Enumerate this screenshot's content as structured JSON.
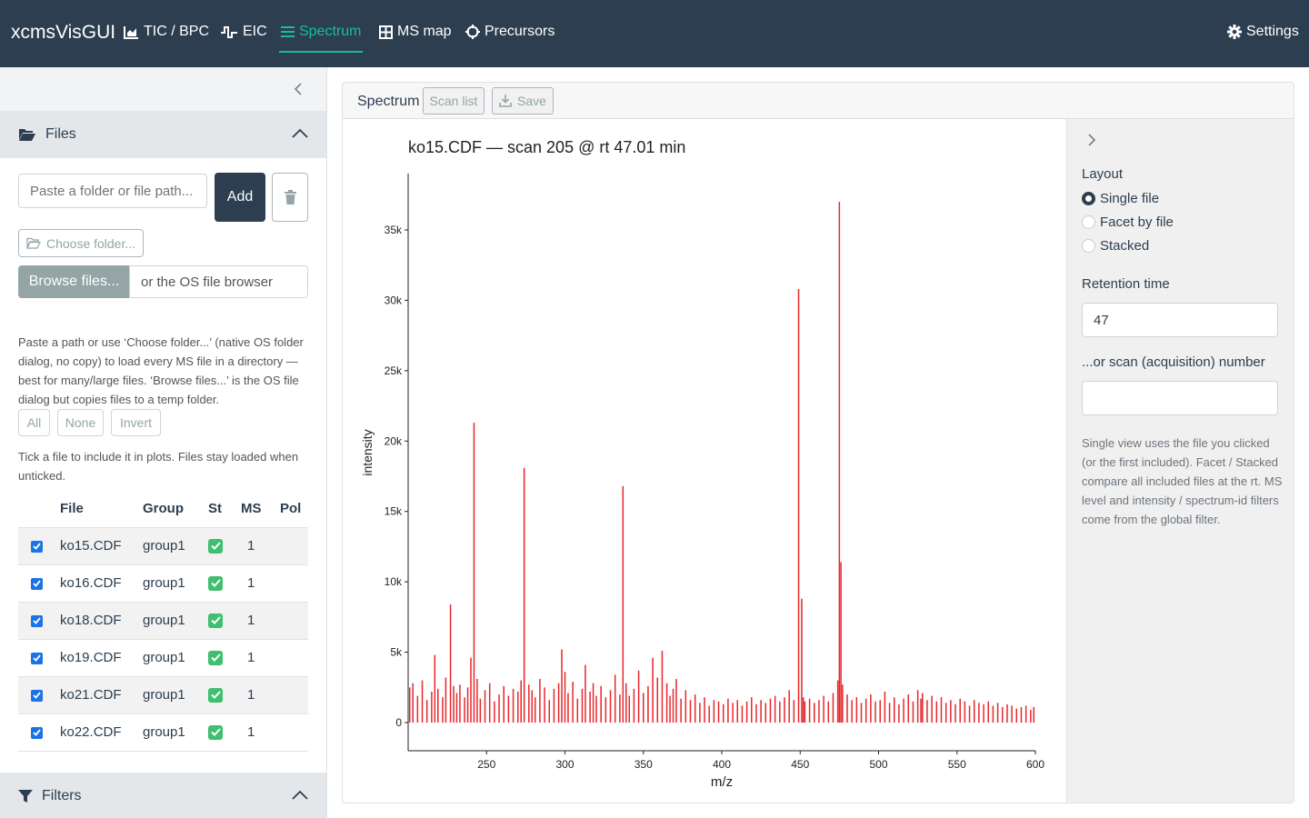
{
  "app": {
    "brand": "xcmsVisGUI"
  },
  "nav": {
    "tic": "TIC / BPC",
    "eic": "EIC",
    "spectrum": "Spectrum",
    "msmap": "MS map",
    "precursors": "Precursors",
    "settings": "Settings"
  },
  "sidebar": {
    "files_header": "Files",
    "path_placeholder": "Paste a folder or file path...",
    "add_label": "Add",
    "choose_folder_label": "Choose folder...",
    "browse_label": "Browse files...",
    "browse_hint": "or the OS file browser",
    "help_text": "Paste a path or use ‘Choose folder...’ (native OS folder dialog, no copy) to load every MS file in a directory — best for many/large files. ‘Browse files...’ is the OS file dialog but copies files to a temp folder.",
    "select_all": "All",
    "select_none": "None",
    "select_invert": "Invert",
    "tick_help": "Tick a file to include it in plots. Files stay loaded when unticked.",
    "table_headers": {
      "file": "File",
      "group": "Group",
      "st": "St",
      "ms": "MS",
      "pol": "Pol"
    },
    "files": [
      {
        "name": "ko15.CDF",
        "group": "group1",
        "ms": "1",
        "pol": ""
      },
      {
        "name": "ko16.CDF",
        "group": "group1",
        "ms": "1",
        "pol": ""
      },
      {
        "name": "ko18.CDF",
        "group": "group1",
        "ms": "1",
        "pol": ""
      },
      {
        "name": "ko19.CDF",
        "group": "group1",
        "ms": "1",
        "pol": ""
      },
      {
        "name": "ko21.CDF",
        "group": "group1",
        "ms": "1",
        "pol": ""
      },
      {
        "name": "ko22.CDF",
        "group": "group1",
        "ms": "1",
        "pol": ""
      }
    ],
    "filters_header": "Filters"
  },
  "main": {
    "card_title": "Spectrum",
    "scan_list_label": "Scan list",
    "save_label": "Save"
  },
  "options": {
    "layout_label": "Layout",
    "layout_single": "Single file",
    "layout_facet": "Facet by file",
    "layout_stacked": "Stacked",
    "rt_label": "Retention time",
    "rt_value": "47",
    "scan_label": "...or scan (acquisition) number",
    "scan_value": "",
    "help_text": "Single view uses the file you clicked (or the first included). Facet / Stacked compare all included files at the rt. MS level and intensity / spectrum-id filters come from the global filter."
  },
  "chart_data": {
    "type": "bar",
    "title": "ko15.CDF — scan 205 @ rt 47.01 min",
    "xlabel": "m/z",
    "ylabel": "intensity",
    "xlim": [
      200,
      600
    ],
    "ylim": [
      -2000,
      39000
    ],
    "x_ticks": [
      250,
      300,
      350,
      400,
      450,
      500,
      550,
      600
    ],
    "x_tick_labels": [
      "250",
      "300",
      "350",
      "400",
      "450",
      "500",
      "550",
      "600"
    ],
    "y_ticks": [
      0,
      5000,
      10000,
      15000,
      20000,
      25000,
      30000,
      35000
    ],
    "y_tick_labels": [
      "0",
      "5k",
      "10k",
      "15k",
      "20k",
      "25k",
      "30k",
      "35k"
    ],
    "grid": false,
    "color": "#e8262b",
    "series": [
      {
        "x": [
          201,
          203,
          206,
          209,
          212,
          215,
          217,
          219,
          222,
          224,
          227,
          229,
          231,
          233,
          236,
          238,
          240,
          242,
          244,
          246,
          249,
          252,
          255,
          258,
          261,
          264,
          267,
          270,
          272,
          274,
          277,
          279,
          281,
          284,
          287,
          290,
          293,
          296,
          298,
          300,
          302,
          305,
          308,
          311,
          313,
          316,
          318,
          320,
          323,
          326,
          329,
          332,
          335,
          337,
          339,
          341,
          344,
          347,
          350,
          353,
          356,
          359,
          362,
          365,
          367,
          369,
          371,
          374,
          377,
          380,
          383,
          386,
          389,
          392,
          395,
          398,
          401,
          404,
          407,
          410,
          413,
          416,
          419,
          422,
          425,
          428,
          431,
          434,
          437,
          440,
          443,
          446,
          449,
          451,
          452,
          453,
          456,
          459,
          462,
          465,
          468,
          471,
          474,
          475,
          476,
          477,
          480,
          483,
          486,
          489,
          492,
          495,
          498,
          501,
          504,
          507,
          510,
          513,
          516,
          519,
          522,
          525,
          527,
          528,
          531,
          534,
          537,
          540,
          543,
          546,
          549,
          552,
          555,
          558,
          561,
          564,
          567,
          570,
          573,
          576,
          579,
          582,
          585,
          588,
          591,
          594,
          597,
          599
        ],
        "y": [
          2500,
          2800,
          1900,
          3000,
          1600,
          2200,
          4800,
          2400,
          1800,
          3200,
          8400,
          2600,
          2100,
          2700,
          1800,
          2500,
          4600,
          21300,
          3100,
          1700,
          2300,
          2800,
          1500,
          2000,
          2600,
          1900,
          2400,
          2200,
          3000,
          18100,
          2700,
          2300,
          1800,
          3100,
          2500,
          1600,
          2400,
          2800,
          5200,
          3600,
          2100,
          2900,
          1700,
          2400,
          4100,
          2200,
          2800,
          1900,
          2600,
          1800,
          2300,
          3400,
          2000,
          16800,
          2800,
          1900,
          2400,
          3700,
          2100,
          2600,
          4600,
          3200,
          5100,
          2800,
          1900,
          2400,
          3100,
          1700,
          2300,
          1600,
          2000,
          1400,
          1800,
          1200,
          1600,
          1500,
          1300,
          1700,
          1400,
          1600,
          1200,
          1500,
          1800,
          1300,
          1600,
          1400,
          1700,
          1900,
          1500,
          1800,
          2300,
          1600,
          30800,
          8800,
          1800,
          1500,
          1700,
          1400,
          1600,
          1900,
          1500,
          2100,
          3000,
          37000,
          11400,
          2700,
          2000,
          1600,
          1800,
          1400,
          1700,
          2000,
          1500,
          1600,
          2200,
          1400,
          1800,
          1300,
          1700,
          2000,
          1500,
          2300,
          1700,
          2100,
          1600,
          1900,
          1500,
          1800,
          1400,
          1600,
          1300,
          1700,
          1500,
          1200,
          1600,
          1400,
          1300,
          1500,
          1200,
          1400,
          1100,
          1300,
          1200,
          1000,
          1100,
          1200,
          900,
          1100
        ]
      }
    ]
  }
}
